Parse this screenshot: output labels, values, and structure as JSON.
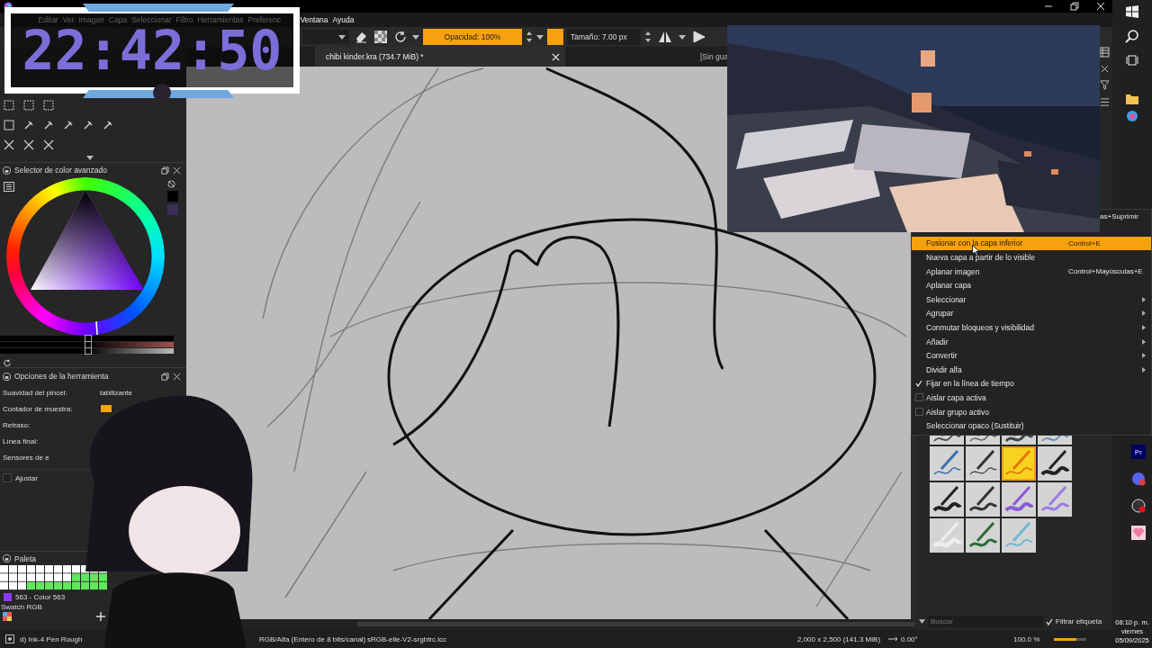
{
  "menu": [
    "Editar",
    "Ver",
    "Imagen",
    "Capa",
    "Seleccionar",
    "Filtro",
    "Herramientas",
    "Preferenc",
    "Ventana",
    "Ayuda"
  ],
  "clock": "22:42:50",
  "toolbar": {
    "opacity": {
      "label": "Opacidad: 100%",
      "level": 1
    },
    "size": "Tamaño: 7.00 px"
  },
  "document_tabs": [
    {
      "label": "chibi kinder.kra (734.7 MiB) *",
      "selected": true
    },
    {
      "label": "[Sin gua",
      "selected": false
    }
  ],
  "color_selector": {
    "title": "Selector de color avanzado",
    "sliders": [
      {
        "level": 0.5
      },
      {
        "level": 0.5
      },
      {
        "level": 0.5
      }
    ]
  },
  "tool_options": {
    "title": "Opciones de la herramienta",
    "fields": [
      {
        "label": "Suavidad del pincel:",
        "value": "tabilizante"
      },
      {
        "label": "Contador de muestra:"
      },
      {
        "label": "Retraso:"
      },
      {
        "label": "Línea final:"
      },
      {
        "label": "Sensores de e"
      }
    ],
    "snap": {
      "label": "Ajustar",
      "checked": false
    }
  },
  "palette": {
    "title": "Paleta",
    "current": "563 - Color 563",
    "footer": "Swatch RGB"
  },
  "context_menu": [
    {
      "kind": "partial",
      "shortcut": "as+Suprimir",
      "selected": false
    },
    {
      "kind": "action",
      "label": "Fusionar con la capa inferior",
      "shortcut": "Control+E",
      "selected": true
    },
    {
      "kind": "action",
      "label": "Nueva capa a partir de lo visible",
      "selected": false
    },
    {
      "kind": "action",
      "label": "Aplanar imagen",
      "shortcut": "Control+Mayúsculas+E",
      "selected": false
    },
    {
      "kind": "action",
      "label": "Aplanar capa",
      "selected": false
    },
    {
      "kind": "submenu",
      "label": "Seleccionar",
      "selected": false
    },
    {
      "kind": "submenu",
      "label": "Agrupar",
      "selected": false
    },
    {
      "kind": "submenu",
      "label": "Conmutar bloqueos y visibilidad",
      "selected": false
    },
    {
      "kind": "submenu",
      "label": "Añadir",
      "selected": false
    },
    {
      "kind": "submenu",
      "label": "Convertir",
      "selected": false
    },
    {
      "kind": "submenu",
      "label": "Dividir alfa",
      "selected": false
    },
    {
      "kind": "check",
      "label": "Fijar en la línea de tiempo",
      "checked": true,
      "selected": false
    },
    {
      "kind": "check",
      "label": "Aislar capa activa",
      "checked": false,
      "selected": false
    },
    {
      "kind": "check",
      "label": "Aislar grupo activo",
      "checked": false,
      "selected": false
    },
    {
      "kind": "action",
      "label": "Seleccionar opaco (Sustituir)",
      "selected": false
    }
  ],
  "brush_presets": [
    {
      "selected": false
    },
    {
      "selected": false
    },
    {
      "selected": false
    },
    {
      "selected": false
    },
    {
      "selected": false
    },
    {
      "selected": false
    },
    {
      "selected": true
    },
    {
      "selected": false
    },
    {
      "selected": false
    },
    {
      "selected": false
    },
    {
      "selected": false
    },
    {
      "selected": false
    },
    {
      "selected": false
    },
    {
      "selected": false
    },
    {
      "selected": false
    }
  ],
  "brush_search": {
    "placeholder": "Buscar"
  },
  "filter_tag": {
    "label": "Filtrar etiqueta",
    "checked": true
  },
  "status": {
    "brush": "d) Ink-4 Pen Rough",
    "color_model": "RGB/Alfa (Entero de 8 bits/canal)",
    "profile": "sRGB-elle-V2-srgbtrc.icc",
    "size": "2,000 x 2,500 (141.3 MiB)",
    "rotation": "0.00°",
    "zoom": "100.0 %",
    "zoom_slider": {
      "level": 0.7
    }
  },
  "taskbar": {
    "app_label": "Pr",
    "time": "08:10 p. m.",
    "day": "viernes",
    "date": "05/09/2025"
  }
}
